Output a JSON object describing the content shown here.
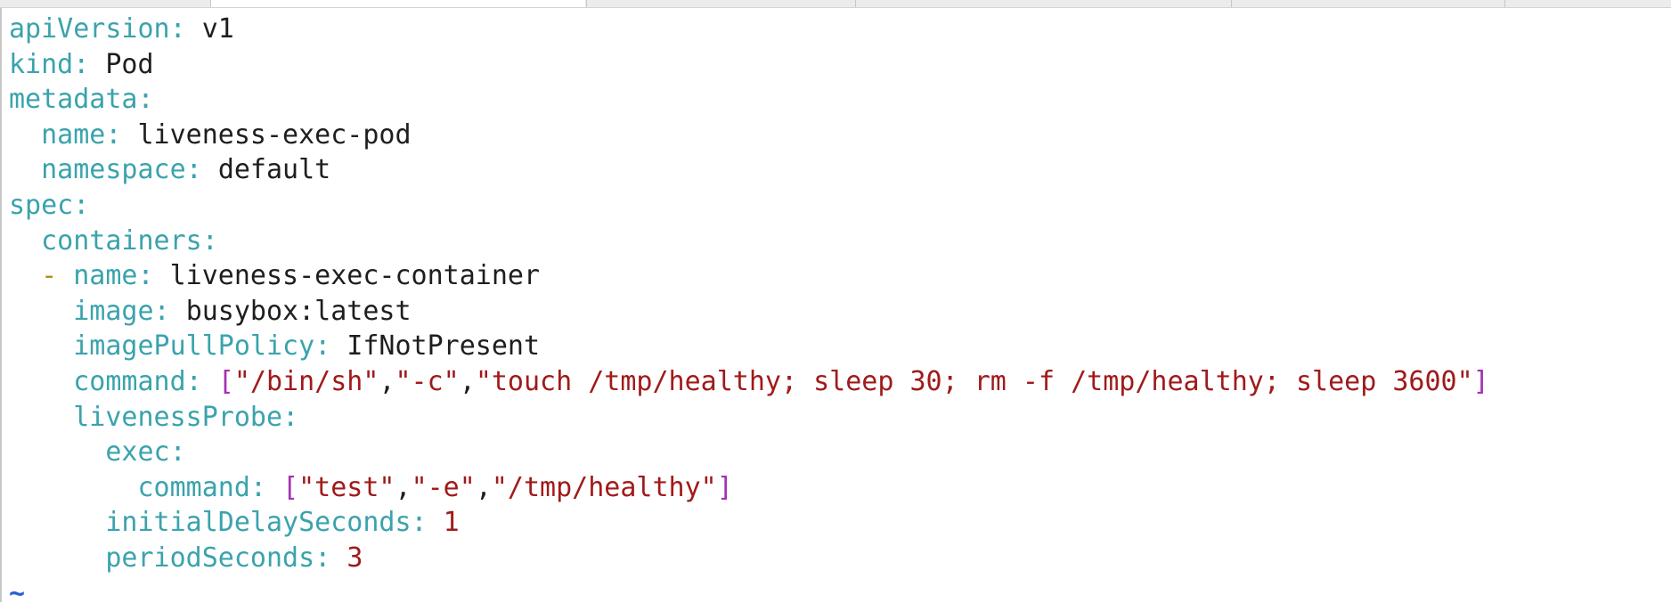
{
  "yaml": {
    "apiVersion": {
      "key": "apiVersion",
      "value": "v1"
    },
    "kind": {
      "key": "kind",
      "value": "Pod"
    },
    "metadata": {
      "key": "metadata"
    },
    "name": {
      "key": "name",
      "value": "liveness-exec-pod"
    },
    "namespace": {
      "key": "namespace",
      "value": "default"
    },
    "spec": {
      "key": "spec"
    },
    "containers": {
      "key": "containers"
    },
    "container_name": {
      "dash": "-",
      "key": "name",
      "value": "liveness-exec-container"
    },
    "image": {
      "key": "image",
      "value": "busybox:latest"
    },
    "imagePullPolicy": {
      "key": "imagePullPolicy",
      "value": "IfNotPresent"
    },
    "command": {
      "key": "command",
      "items": [
        "\"/bin/sh\"",
        "\"-c\"",
        "\"touch /tmp/healthy; sleep 30; rm -f /tmp/healthy; sleep 3600\""
      ]
    },
    "livenessProbe": {
      "key": "livenessProbe"
    },
    "exec": {
      "key": "exec"
    },
    "probe_command": {
      "key": "command",
      "items": [
        "\"test\"",
        "\"-e\"",
        "\"/tmp/healthy\""
      ]
    },
    "initialDelaySeconds": {
      "key": "initialDelaySeconds",
      "value": "1"
    },
    "periodSeconds": {
      "key": "periodSeconds",
      "value": "3"
    }
  },
  "editor": {
    "empty_line_marker": "~"
  },
  "colors": {
    "key": "#3aa3ad",
    "value": "#1e1e1e",
    "string": "#a11a1a",
    "number": "#a11a1a",
    "bracket": "#a232b3",
    "dash": "#b58f0c",
    "tilde": "#2a5fd6"
  }
}
